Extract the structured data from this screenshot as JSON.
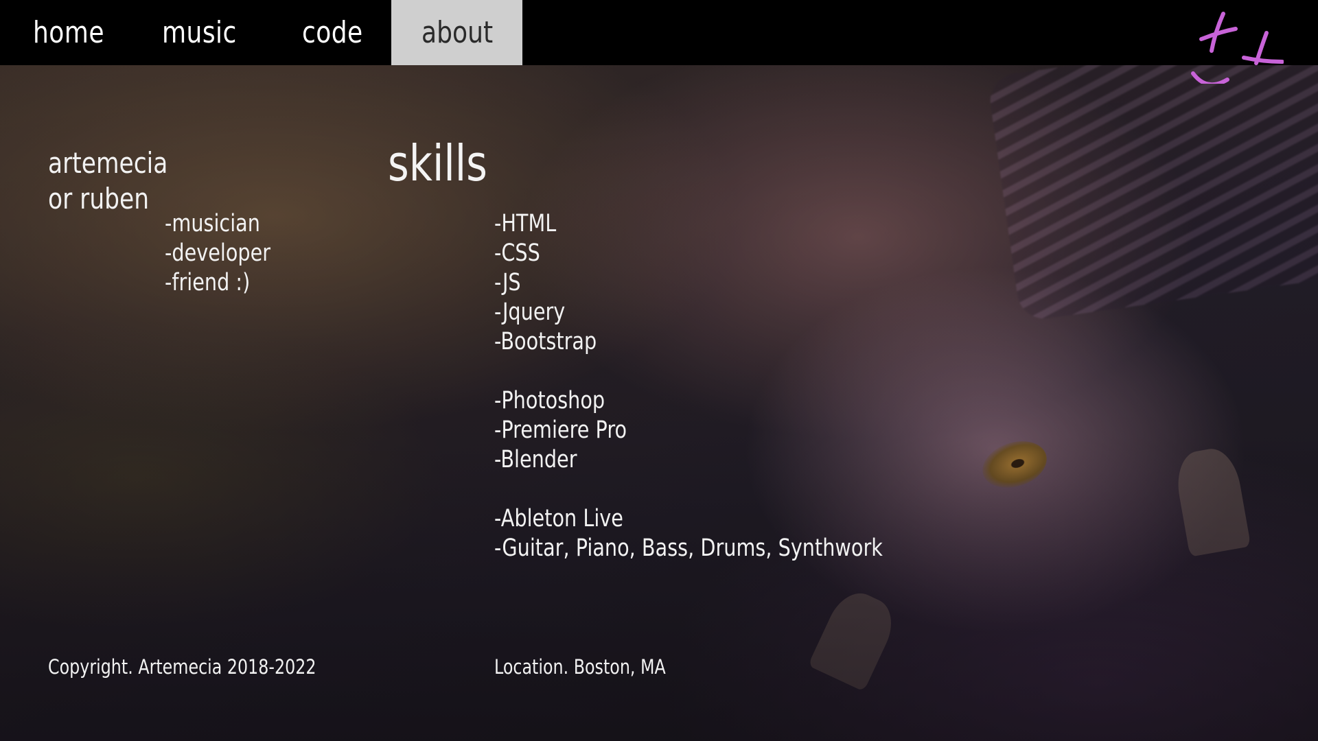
{
  "nav": {
    "items": [
      {
        "label": "home"
      },
      {
        "label": "music"
      },
      {
        "label": "code"
      },
      {
        "label": "about"
      }
    ],
    "active": "about",
    "active_bg": "#cfcfcf"
  },
  "logo": {
    "icon": "smiley-logo-icon",
    "color": "#c863d8"
  },
  "profile": {
    "name_line1": "artemecia",
    "name_line2": "or ruben",
    "roles": [
      "-musician",
      "-developer",
      "-friend :)"
    ]
  },
  "skills": {
    "title": "skills",
    "groups": [
      [
        "-HTML",
        "-CSS",
        "-JS",
        "-Jquery",
        "-Bootstrap"
      ],
      [
        "-Photoshop",
        "-Premiere Pro",
        "-Blender"
      ],
      [
        "-Ableton Live",
        "-Guitar, Piano, Bass, Drums, Synthwork"
      ]
    ]
  },
  "footer": {
    "copyright": "Copyright. Artemecia 2018-2022",
    "location": "Location. Boston, MA"
  },
  "background": {
    "description_icon": "cat-photo-background"
  }
}
